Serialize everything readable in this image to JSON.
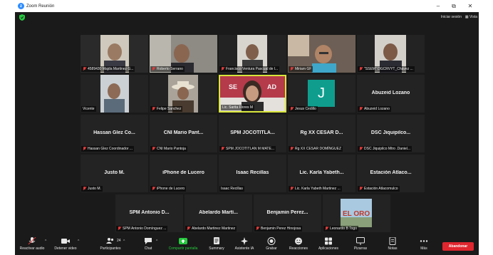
{
  "window": {
    "title": "Zoom Reunión"
  },
  "top_bar": {
    "login": "Iniciar sesión",
    "view": "Vista"
  },
  "tiles_row1": [
    {
      "label": "4589430 Majda Martinez G...",
      "muted": true
    },
    {
      "label": "Roberto Serrano",
      "muted": true
    },
    {
      "label": "Francisco Ventura Pascual de l...",
      "muted": true
    },
    {
      "label": "Miriam GF",
      "muted": true
    },
    {
      "label": "\"SSEM\" DGCRVYT_Chávez ...",
      "muted": true
    }
  ],
  "tiles_row2": [
    {
      "label": "Vicente",
      "muted": false
    },
    {
      "label": "Felipe Sanchez",
      "muted": true
    },
    {
      "label": "Lic. Sarita Flores M",
      "muted": false
    },
    {
      "label": "Jesus Cedillo",
      "muted": true,
      "avatar_letter": "J"
    },
    {
      "label": "Abuzeid Lozano",
      "muted": true,
      "big": "Abuzeid Lozano"
    }
  ],
  "tiles_row3": [
    {
      "label": "Hassan Glez Coordinador ...",
      "muted": true,
      "big": "Hassan Glez Co..."
    },
    {
      "label": "CNI Mario Pantoja",
      "muted": true,
      "big": "CNI Mario Pant..."
    },
    {
      "label": "SPM JOCOTITLAN M MATE...",
      "muted": true,
      "big": "SPM JOCOTITLA..."
    },
    {
      "label": "Rg XX CESAR DOMÍNGUEZ",
      "muted": true,
      "big": "Rg XX CESAR D..."
    },
    {
      "label": "DSC Jiquipilco Mtro .Daniel...",
      "muted": true,
      "big": "DSC Jiquipilco..."
    }
  ],
  "tiles_row4": [
    {
      "label": "Justo M.",
      "muted": true,
      "big": "Justo M."
    },
    {
      "label": "iPhone de Lucero",
      "muted": true,
      "big": "iPhone de Lucero"
    },
    {
      "label": "Isaac Recillas",
      "muted": false,
      "big": "Isaac Recillas"
    },
    {
      "label": "Lic. Karla Yabeth Martinez ...",
      "muted": true,
      "big": "Lic. Karla Yabeth..."
    },
    {
      "label": "Estación Atlacomulco",
      "muted": true,
      "big": "Estación Atlaco..."
    }
  ],
  "tiles_row5": [
    {
      "label": "SPM Antonio Domínguez ...",
      "muted": true,
      "big": "SPM Antonio D..."
    },
    {
      "label": "Abelardo Martinez Martinez",
      "muted": true,
      "big": "Abelardo Martí..."
    },
    {
      "label": "Benjamin Perez Hinojosa",
      "muted": true,
      "big": "Benjamin Perez..."
    },
    {
      "label": "Leonardo B Togo",
      "muted": true,
      "image_text": "EL ORO"
    }
  ],
  "sarita_banner": {
    "left": "SE",
    "right": "AD"
  },
  "toolbar": {
    "unmute": "Reactivar audio",
    "stop_video": "Detener video",
    "participants": "Participantes",
    "participants_count": "24",
    "chat": "Chat",
    "share": "Compartir pantalla",
    "summary": "Summary",
    "ai": "Asistente IA",
    "record": "Grabar",
    "reactions": "Reacciones",
    "apps": "Aplicaciones",
    "whiteboards": "Pizarras",
    "notes": "Notas",
    "more": "Más",
    "end": "Abandonar"
  },
  "colors": {
    "background": "#1a1a1a",
    "tile": "#232323",
    "active_speaker": "#d8e63b",
    "share_green": "#27c93f",
    "end_red": "#e0262f",
    "mute_red": "#e23a3a",
    "avatar_teal": "#0f9e8e",
    "zoom_blue": "#2d8cff"
  }
}
